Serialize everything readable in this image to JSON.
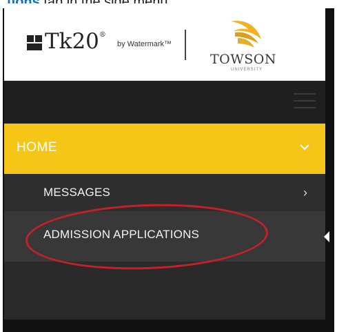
{
  "caption": {
    "highlight": "tions",
    "text": " tab in the side menu."
  },
  "brand": {
    "tk20_name": "Tk20",
    "tk20_mark": "®",
    "by_watermark": "by Watermark™",
    "university_name": "TOWSON",
    "university_sub": "UNIVERSITY"
  },
  "menu": {
    "home_label": "HOME",
    "items": [
      {
        "label": "MESSAGES"
      },
      {
        "label": "ADMISSION APPLICATIONS"
      }
    ]
  },
  "colors": {
    "home_bar": "#f5c518",
    "highlight_ring": "#c8202a",
    "sidebar_dark": "#2e2e2e"
  }
}
